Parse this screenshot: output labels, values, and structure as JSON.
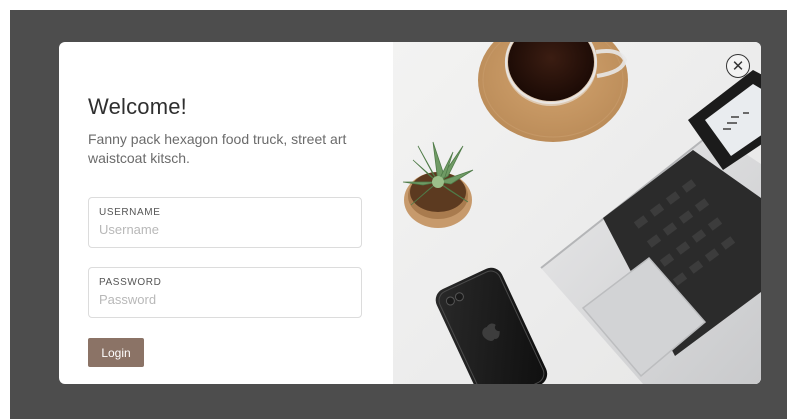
{
  "modal": {
    "title": "Welcome!",
    "subtitle": "Fanny pack hexagon food truck, street art waistcoat kitsch.",
    "username": {
      "label": "USERNAME",
      "placeholder": "Username",
      "value": ""
    },
    "password": {
      "label": "PASSWORD",
      "placeholder": "Password",
      "value": ""
    },
    "login_label": "Login",
    "close_icon": "close-icon"
  },
  "colors": {
    "backdrop": "#4d4d4d",
    "login_button": "#8b7366",
    "title_text": "#2f2f2f",
    "body_text": "#6b6b6b"
  },
  "image": {
    "depicts": [
      "coffee-cup",
      "cork-coaster",
      "succulent-plant",
      "smartphone",
      "laptop"
    ]
  }
}
